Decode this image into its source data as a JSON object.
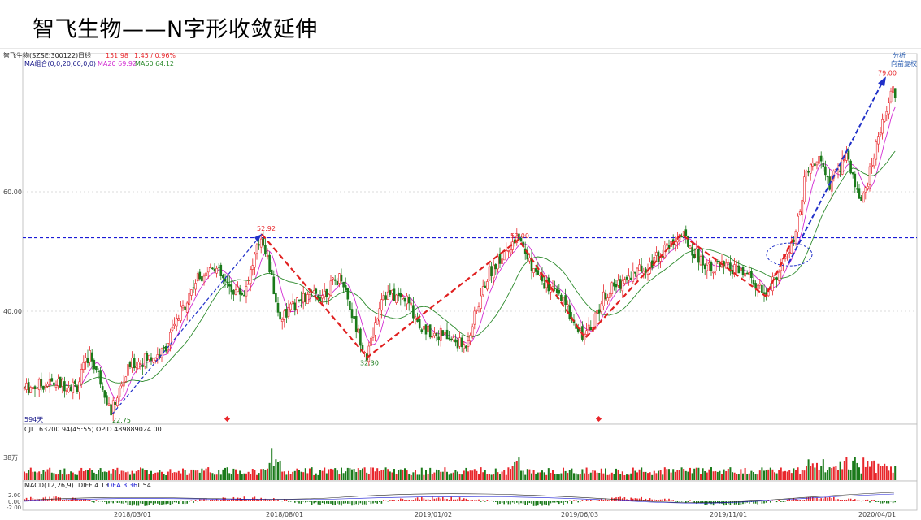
{
  "page": {
    "title": "智飞生物——N字形收敛延伸"
  },
  "header": {
    "symbol": "智飞生物(SZSE:300122)",
    "period": "日线",
    "last": "151.98",
    "change": "1.45 / 0.96%",
    "ma_label": "MA组合(0,0,20,60,0,0)",
    "ma20": "MA20 69.92",
    "ma60": "MA60 64.12",
    "right_top": "分析",
    "right_sub": "向前复权"
  },
  "volume_panel": {
    "label": "CJL",
    "values": "63200.94(45:55)  OPID 489889024.00",
    "scale_label": "38万"
  },
  "macd_panel": {
    "label": "MACD(12,26,9)",
    "diff": "DIFF 4.13",
    "dea": "DEA 3.36",
    "macd": "1.54",
    "ticks": [
      "2.00",
      "0.00",
      "-2.00"
    ]
  },
  "days_label": "594天",
  "colors": {
    "up": "#e8262b",
    "down": "#1a7a1a",
    "ma20": "#d22bd2",
    "ma60": "#2e8b2e",
    "pattern": "#e02020",
    "trend": "#2030c8",
    "resistance": "#1a1ad6"
  },
  "chart_data": {
    "type": "candlestick",
    "price_axis": {
      "ticks": [
        40,
        60
      ],
      "tick_labels": [
        "40.00",
        "60.00"
      ],
      "range": [
        22,
        80
      ]
    },
    "date_labels": [
      "2018/03/01",
      "2018/08/01",
      "2019/01/02",
      "2019/06/03",
      "2019/11/01",
      "2020/04/01"
    ],
    "annotations": [
      {
        "label": "22.75",
        "value": 22.75,
        "date": "2018/02"
      },
      {
        "label": "52.92",
        "value": 52.92,
        "date": "2018/08"
      },
      {
        "label": "32.30",
        "value": 32.3,
        "date": "2018/12"
      },
      {
        "label": "52.00",
        "value": 52.0,
        "date": "2019/05"
      },
      {
        "label": "79.00",
        "value": 79.0,
        "date": "2020/04"
      }
    ],
    "resistance_level": 52.3,
    "pattern_path": [
      {
        "date": "2018/08",
        "price": 52.9
      },
      {
        "date": "2018/12",
        "price": 32.3
      },
      {
        "date": "2019/05",
        "price": 52.0
      },
      {
        "date": "2019/07",
        "price": 35.5
      },
      {
        "date": "2019/09",
        "price": 52.9
      },
      {
        "date": "2019/11",
        "price": 42.5
      },
      {
        "date": "2019/12",
        "price": 52.0
      }
    ],
    "trend_lines": [
      {
        "from": {
          "date": "2018/02",
          "price": 22.75
        },
        "to": {
          "date": "2018/08",
          "price": 52.9
        }
      },
      {
        "from": {
          "date": "2019/12",
          "price": 48.0
        },
        "to": {
          "date": "2020/04",
          "price": 79.0
        }
      }
    ],
    "series": [
      {
        "name": "MA20",
        "value_label": "69.92"
      },
      {
        "name": "MA60",
        "value_label": "64.12"
      }
    ]
  }
}
